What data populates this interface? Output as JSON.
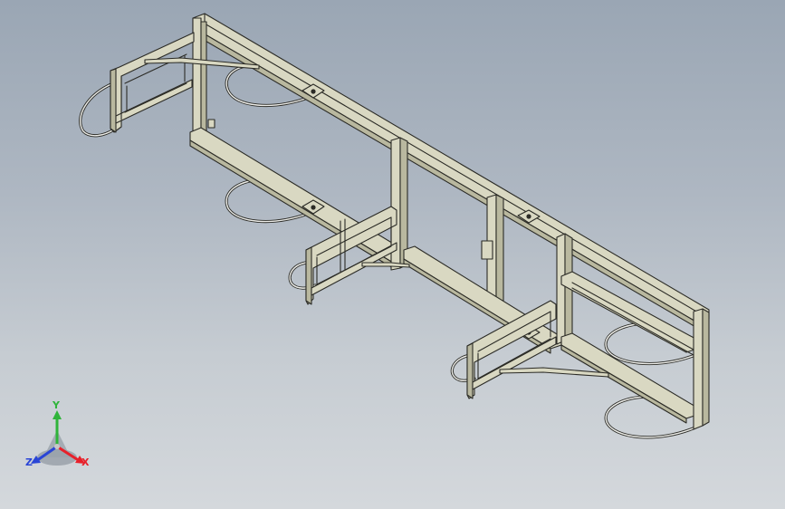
{
  "viewport": {
    "triad": {
      "x_label": "X",
      "y_label": "Y",
      "z_label": "Z",
      "x_color": "#e8202a",
      "y_color": "#2fb43a",
      "z_color": "#2a45d6"
    },
    "colors": {
      "background_top": "#9aa6b4",
      "background_bottom": "#d4d8dc",
      "frame_fill": "#d9d8c2",
      "frame_shade": "#b9b89f",
      "edge": "#2b2b26",
      "hoop_wire": "#eeeeea"
    }
  }
}
